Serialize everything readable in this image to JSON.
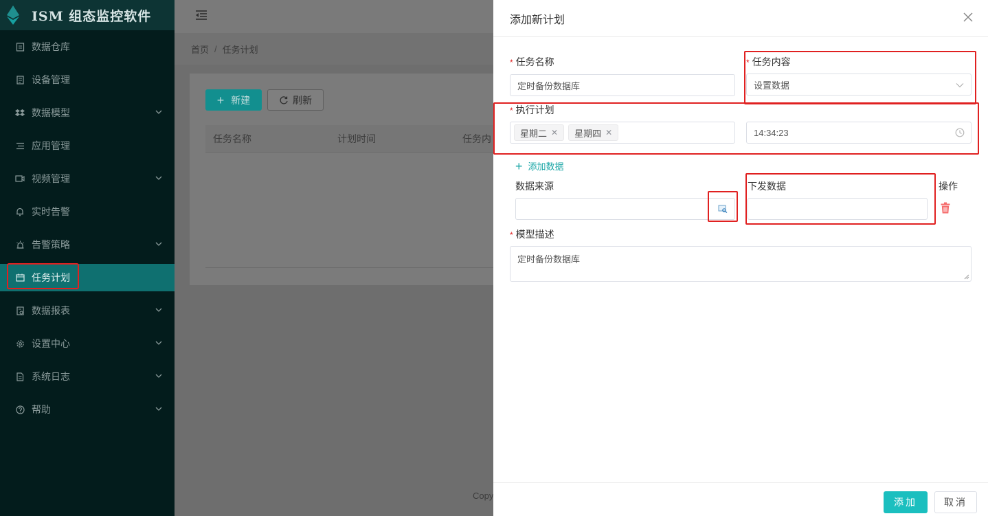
{
  "app": {
    "title": "ISM 组态监控软件"
  },
  "sidebar": {
    "items": [
      {
        "label": "数据仓库",
        "icon": "database-icon"
      },
      {
        "label": "设备管理",
        "icon": "device-icon"
      },
      {
        "label": "数据模型",
        "icon": "dropbox-icon"
      },
      {
        "label": "应用管理",
        "icon": "list-icon"
      },
      {
        "label": "视频管理",
        "icon": "video-icon"
      },
      {
        "label": "实时告警",
        "icon": "bell-icon"
      },
      {
        "label": "告警策略",
        "icon": "alarm-icon"
      },
      {
        "label": "任务计划",
        "icon": "calendar-icon",
        "active": true
      },
      {
        "label": "数据报表",
        "icon": "report-icon"
      },
      {
        "label": "设置中心",
        "icon": "gear-icon"
      },
      {
        "label": "系统日志",
        "icon": "log-icon"
      },
      {
        "label": "帮助",
        "icon": "help-icon"
      }
    ]
  },
  "breadcrumb": {
    "home": "首页",
    "sep": "/",
    "current": "任务计划"
  },
  "toolbar": {
    "new_label": "新建",
    "refresh_label": "刷新"
  },
  "table": {
    "columns": [
      "任务名称",
      "计划时间",
      "任务内"
    ]
  },
  "footer": {
    "copy": "Copy"
  },
  "drawer": {
    "title": "添加新计划",
    "task_name": {
      "label": "任务名称",
      "value": "定时备份数据库"
    },
    "task_content": {
      "label": "任务内容",
      "value": "设置数据"
    },
    "schedule": {
      "label": "执行计划",
      "tags": [
        "星期二",
        "星期四"
      ],
      "time": "14:34:23"
    },
    "add_data_label": "添加数据",
    "data_source": {
      "label": "数据来源",
      "value": ""
    },
    "issue_data": {
      "label": "下发数据",
      "value": ""
    },
    "operation_label": "操作",
    "description": {
      "label": "模型描述",
      "value": "定时备份数据库"
    },
    "add_button": "添加",
    "cancel_button": "取消"
  },
  "colors": {
    "accent": "#1bbfbf",
    "sidebar_bg": "#031c1c",
    "active_bg": "#0f7070",
    "highlight": "#e02020",
    "danger": "#f56c6c"
  }
}
